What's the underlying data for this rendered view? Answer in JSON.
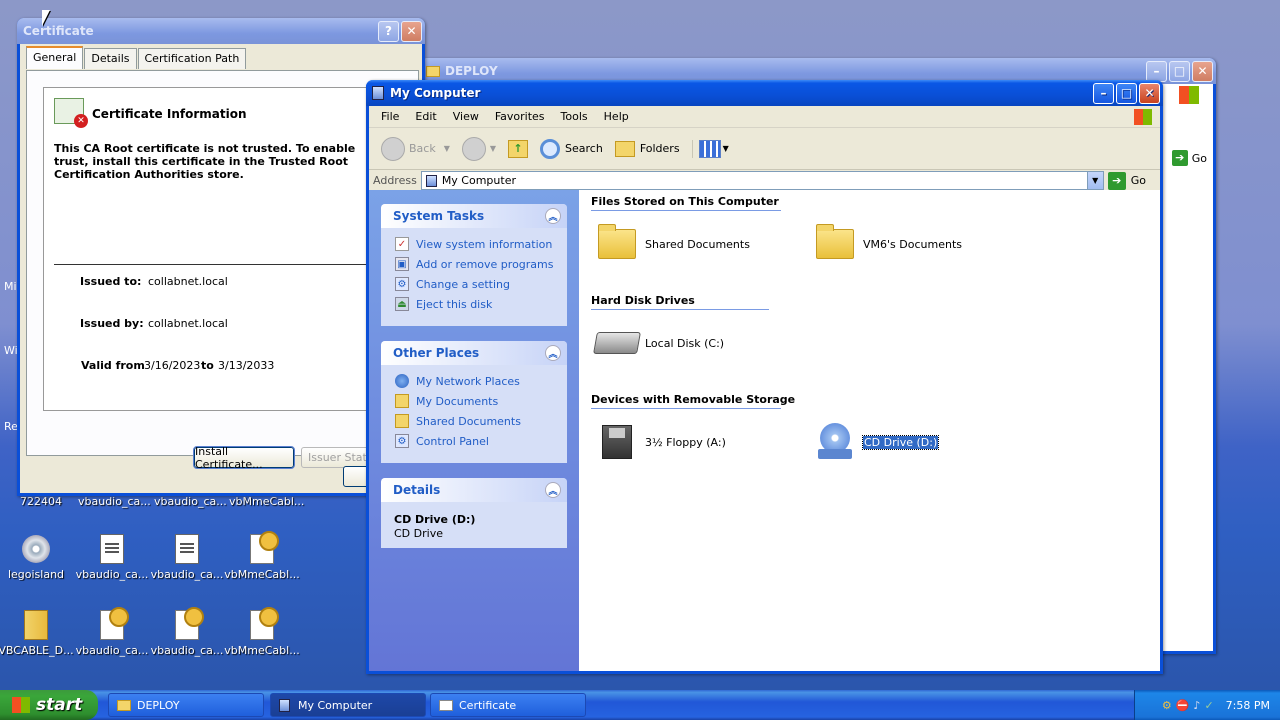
{
  "desktop": {
    "icons": [
      {
        "label": "legoisland"
      },
      {
        "label": "vbaudio_ca..."
      },
      {
        "label": "vbaudio_ca..."
      },
      {
        "label": "vbMmeCabl..."
      },
      {
        "label": "VBCABLE_D..."
      },
      {
        "label": "vbaudio_ca..."
      },
      {
        "label": "vbaudio_ca..."
      },
      {
        "label": "vbMmeCabl..."
      }
    ],
    "partial_labels": [
      "722404",
      "vbaudio_ca...",
      "vbaudio_ca...",
      "vbMmeCabl..."
    ],
    "edge_labels": [
      "Mi",
      "Wi",
      "Re"
    ]
  },
  "certificate": {
    "title": "Certificate",
    "tabs": [
      "General",
      "Details",
      "Certification Path"
    ],
    "header": "Certificate Information",
    "message": "This CA Root certificate is not trusted. To enable trust, install this certificate in the Trusted Root Certification Authorities store.",
    "issued_to_label": "Issued to:",
    "issued_to": "collabnet.local",
    "issued_by_label": "Issued by:",
    "issued_by": "collabnet.local",
    "valid_from_label": "Valid from",
    "valid_from": "3/16/2023",
    "to_label": "to",
    "valid_to": "3/13/2033",
    "install_button": "Install Certificate...",
    "issuer_button": "Issuer Statement"
  },
  "deploy": {
    "title": "DEPLOY",
    "go": "Go"
  },
  "explorer": {
    "title": "My Computer",
    "menu": [
      "File",
      "Edit",
      "View",
      "Favorites",
      "Tools",
      "Help"
    ],
    "toolbar": {
      "back": "Back",
      "search": "Search",
      "folders": "Folders"
    },
    "address_label": "Address",
    "address_value": "My Computer",
    "go": "Go",
    "system_tasks": {
      "title": "System Tasks",
      "items": [
        "View system information",
        "Add or remove programs",
        "Change a setting",
        "Eject this disk"
      ]
    },
    "other_places": {
      "title": "Other Places",
      "items": [
        "My Network Places",
        "My Documents",
        "Shared Documents",
        "Control Panel"
      ]
    },
    "details": {
      "title": "Details",
      "name": "CD Drive (D:)",
      "type": "CD Drive"
    },
    "groups": {
      "files": "Files Stored on This Computer",
      "hdd": "Hard Disk Drives",
      "removable": "Devices with Removable Storage"
    },
    "items": {
      "shared_docs": "Shared Documents",
      "vm6_docs": "VM6's Documents",
      "local_disk": "Local Disk (C:)",
      "floppy": "3½ Floppy (A:)",
      "cd_drive": "CD Drive (D:)"
    }
  },
  "taskbar": {
    "start": "start",
    "items": [
      "DEPLOY",
      "My Computer",
      "Certificate"
    ],
    "clock": "7:58 PM"
  }
}
